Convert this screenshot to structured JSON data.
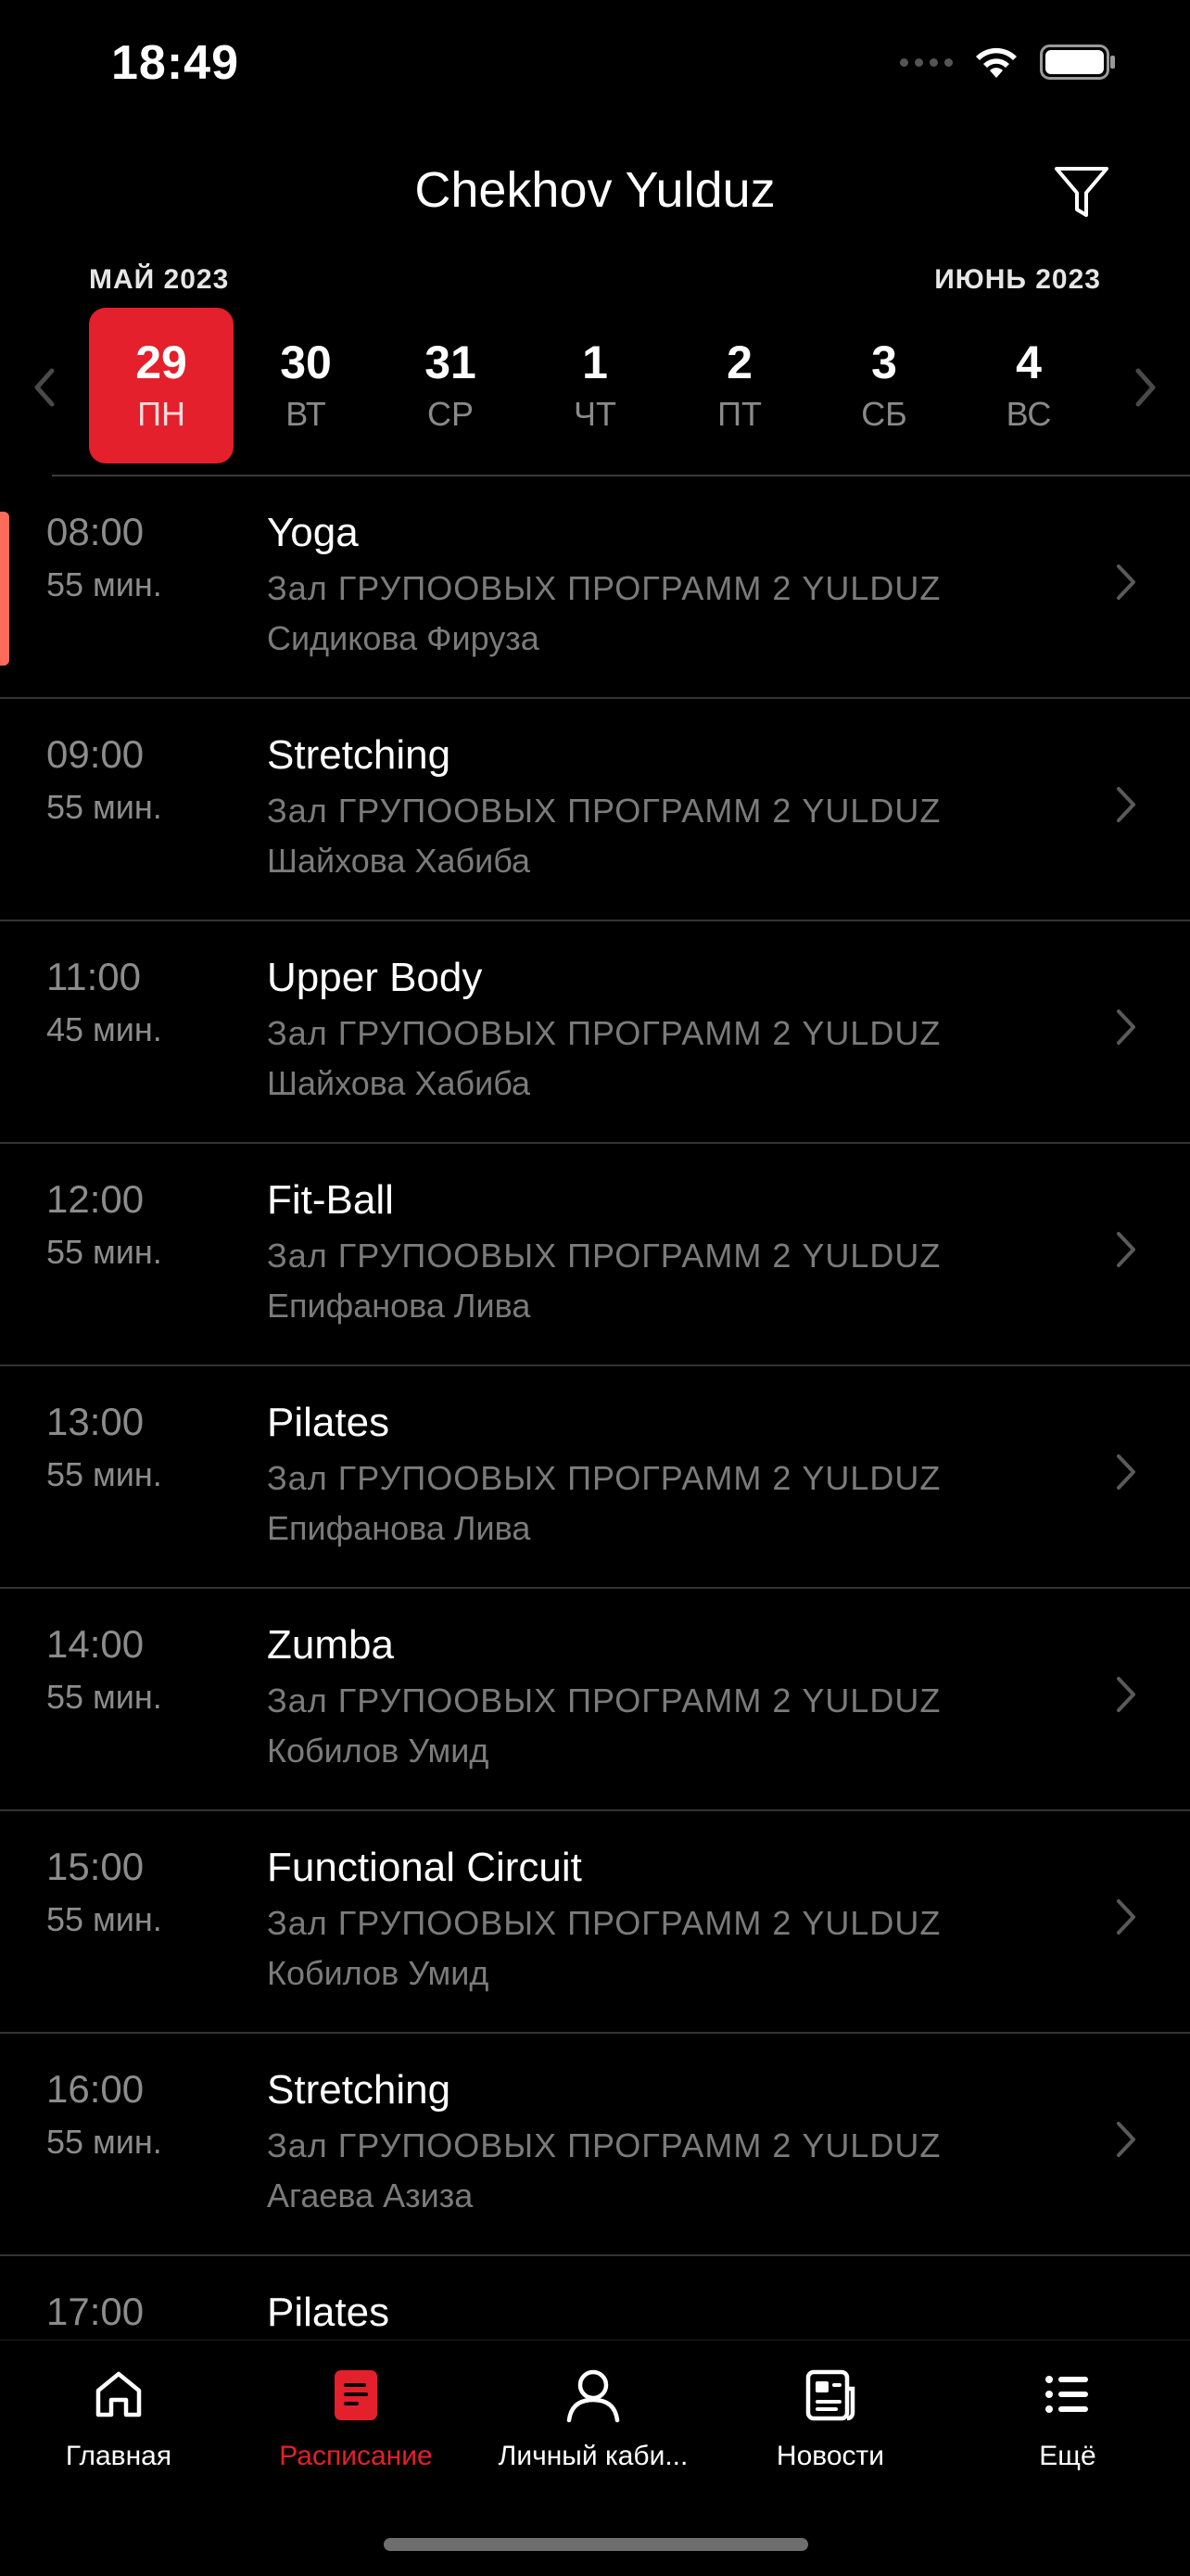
{
  "status_bar": {
    "time": "18:49"
  },
  "header": {
    "title": "Chekhov Yulduz",
    "filter_icon": "filter-funnel-icon"
  },
  "calendar": {
    "left_month": "МАЙ 2023",
    "right_month": "ИЮНЬ 2023",
    "days": [
      {
        "num": "29",
        "name": "ПН",
        "selected": true
      },
      {
        "num": "30",
        "name": "ВТ"
      },
      {
        "num": "31",
        "name": "СР"
      },
      {
        "num": "1",
        "name": "ЧТ"
      },
      {
        "num": "2",
        "name": "ПТ"
      },
      {
        "num": "3",
        "name": "СБ"
      },
      {
        "num": "4",
        "name": "ВС"
      }
    ]
  },
  "sessions": [
    {
      "time": "08:00",
      "duration": "55 мин.",
      "title": "Yoga",
      "room": "Зал ГРУПООВЫХ ПРОГРАММ 2 YULDUZ",
      "trainer": "Сидикова Фируза"
    },
    {
      "time": "09:00",
      "duration": "55 мин.",
      "title": "Stretching",
      "room": "Зал ГРУПООВЫХ ПРОГРАММ 2 YULDUZ",
      "trainer": "Шайхова Хабиба"
    },
    {
      "time": "11:00",
      "duration": "45 мин.",
      "title": "Upper Body",
      "room": "Зал ГРУПООВЫХ ПРОГРАММ 2 YULDUZ",
      "trainer": "Шайхова Хабиба"
    },
    {
      "time": "12:00",
      "duration": "55 мин.",
      "title": "Fit-Ball",
      "room": "Зал ГРУПООВЫХ ПРОГРАММ 2 YULDUZ",
      "trainer": "Епифанова Лива"
    },
    {
      "time": "13:00",
      "duration": "55 мин.",
      "title": "Pilates",
      "room": "Зал ГРУПООВЫХ ПРОГРАММ 2 YULDUZ",
      "trainer": "Епифанова Лива"
    },
    {
      "time": "14:00",
      "duration": "55 мин.",
      "title": "Zumba",
      "room": "Зал ГРУПООВЫХ ПРОГРАММ 2 YULDUZ",
      "trainer": "Кобилов Умид"
    },
    {
      "time": "15:00",
      "duration": "55 мин.",
      "title": "Functional Circuit",
      "room": "Зал ГРУПООВЫХ ПРОГРАММ 2 YULDUZ",
      "trainer": "Кобилов Умид"
    },
    {
      "time": "16:00",
      "duration": "55 мин.",
      "title": "Stretching",
      "room": "Зал ГРУПООВЫХ ПРОГРАММ 2 YULDUZ",
      "trainer": "Агаева Азиза"
    },
    {
      "time": "17:00",
      "duration": "",
      "title": "Pilates",
      "room": "",
      "trainer": ""
    }
  ],
  "tab_bar": {
    "items": [
      {
        "label": "Главная",
        "icon": "home-icon"
      },
      {
        "label": "Расписание",
        "icon": "schedule-icon",
        "active": true
      },
      {
        "label": "Личный каби...",
        "icon": "profile-icon"
      },
      {
        "label": "Новости",
        "icon": "news-icon"
      },
      {
        "label": "Ещё",
        "icon": "more-list-icon"
      }
    ]
  },
  "colors": {
    "accent": "#e3202b",
    "current_marker": "#ff6b5a",
    "secondary_text": "#8c8c8c"
  }
}
